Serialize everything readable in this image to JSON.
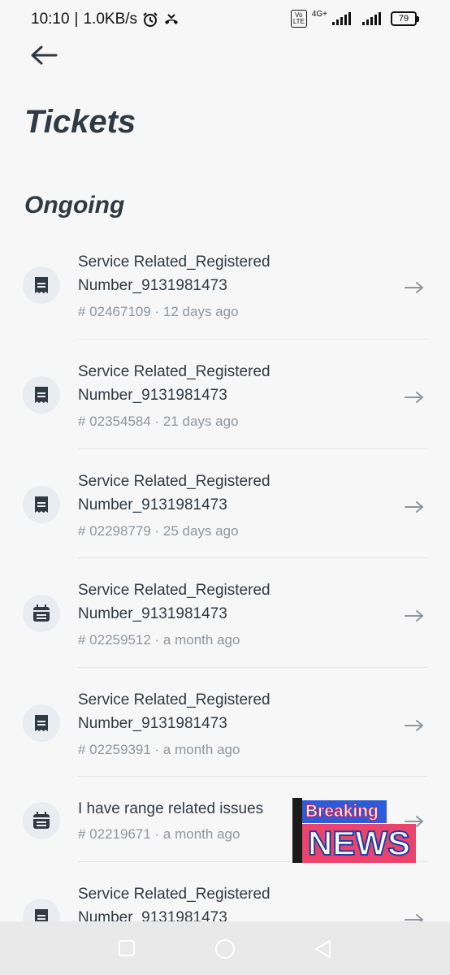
{
  "status_bar": {
    "time": "10:10",
    "network_speed": "1.0KB/s",
    "volte_label": "Vo LTE",
    "network_type": "4G+",
    "battery": "79"
  },
  "header": {
    "title": "Tickets"
  },
  "section": {
    "title": "Ongoing"
  },
  "tickets": [
    {
      "title": "Service Related_Registered Number_9131981473",
      "meta": "# 02467109 · 12 days ago",
      "icon": "receipt-icon"
    },
    {
      "title": "Service Related_Registered Number_9131981473",
      "meta": "# 02354584 · 21 days ago",
      "icon": "receipt-icon"
    },
    {
      "title": "Service Related_Registered Number_9131981473",
      "meta": "# 02298779 · 25 days ago",
      "icon": "receipt-icon"
    },
    {
      "title": "Service Related_Registered Number_9131981473",
      "meta": "# 02259512 · a month ago",
      "icon": "calendar-icon"
    },
    {
      "title": "Service Related_Registered Number_9131981473",
      "meta": "# 02259391 · a month ago",
      "icon": "receipt-icon"
    },
    {
      "title": "I have range related issues",
      "meta": "# 02219671 · a month ago",
      "icon": "calendar-icon"
    },
    {
      "title": "Service Related_Registered Number_9131981473",
      "meta": "",
      "icon": "receipt-icon"
    }
  ],
  "overlay": {
    "breaking": "Breaking",
    "news": "NEWS"
  },
  "colors": {
    "background": "#f7f7f7",
    "text_primary": "#2f3a45",
    "text_secondary": "#8d97a0",
    "icon_bg": "#e9edf1"
  }
}
